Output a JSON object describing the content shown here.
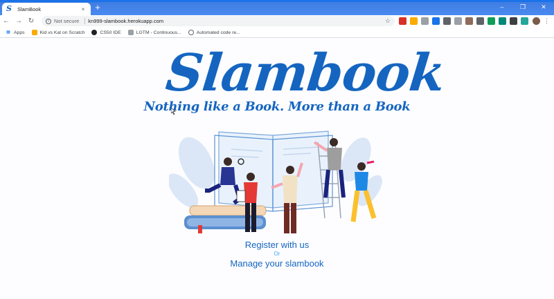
{
  "browser": {
    "tab_title": "SlamBook",
    "tab_close": "×",
    "new_tab": "+",
    "window_controls": [
      "–",
      "❐",
      "✕"
    ],
    "security_label": "Not secure",
    "url": "kn999-slambook.herokuapp.com",
    "bookmarks": [
      "Apps",
      "Kid vs Kat on Scratch",
      "CS50 IDE",
      "LGTM - Continuous...",
      "Automated code re..."
    ]
  },
  "page": {
    "logo": "Slambook",
    "tagline": "Nothing like a Book. More than a Book",
    "register_link": "Register with us",
    "or_text": "Or",
    "manage_link": "Manage your slambook"
  },
  "colors": {
    "brand_blue": "#1565c0",
    "accent_blue": "#42a5f5",
    "tab_strip": "#4285f4"
  }
}
